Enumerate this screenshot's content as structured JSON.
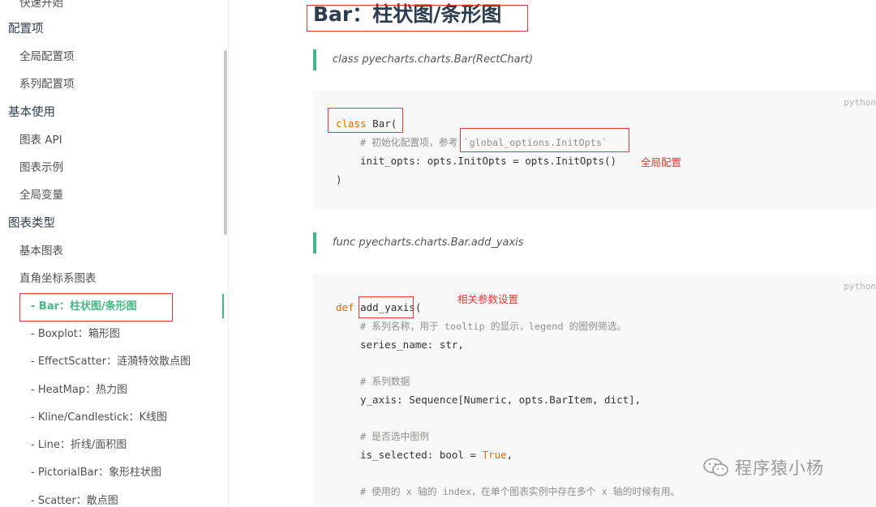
{
  "sidebar": {
    "items": [
      {
        "label": "快速开始",
        "level": 1
      },
      {
        "label": "配置项",
        "level": 0
      },
      {
        "label": "全局配置项",
        "level": 1
      },
      {
        "label": "系列配置项",
        "level": 1
      },
      {
        "label": "基本使用",
        "level": 0
      },
      {
        "label": "图表 API",
        "level": 1
      },
      {
        "label": "图表示例",
        "level": 1
      },
      {
        "label": "全局变量",
        "level": 1
      },
      {
        "label": "图表类型",
        "level": 0
      },
      {
        "label": "基本图表",
        "level": 1
      },
      {
        "label": "直角坐标系图表",
        "level": 1
      },
      {
        "label": "- Bar：柱状图/条形图",
        "level": 2,
        "active": true
      },
      {
        "label": "- Boxplot：箱形图",
        "level": 2
      },
      {
        "label": "- EffectScatter：涟漪特效散点图",
        "level": 2
      },
      {
        "label": "- HeatMap：热力图",
        "level": 2
      },
      {
        "label": "- Kline/Candlestick：K线图",
        "level": 2
      },
      {
        "label": "- Line：折线/面积图",
        "level": 2
      },
      {
        "label": "- PictorialBar：象形柱状图",
        "level": 2
      },
      {
        "label": "- Scatter：散点图",
        "level": 2
      }
    ]
  },
  "main": {
    "title": "Bar：柱状图/条形图",
    "class_signature": "class pyecharts.charts.Bar(RectChart)",
    "func_signature": "func pyecharts.charts.Bar.add_yaxis",
    "code_lang": "python",
    "block1": {
      "l1_kw": "class",
      "l1_rest": " Bar(",
      "l2": "# 初始化配置项，参考 `global_options.InitOpts`",
      "l3": "init_opts: opts.InitOpts = opts.InitOpts()",
      "l4": ")"
    },
    "block2": {
      "l1_kw": "def",
      "l1_rest": " add_yaxis(",
      "l2": "# 系列名称，用于 tooltip 的显示，legend 的图例筛选。",
      "l3": "series_name: str,",
      "l4": "# 系列数据",
      "l5": "y_axis: Sequence[Numeric, opts.BarItem, dict],",
      "l6": "# 是否选中图例",
      "l7_a": "is_selected: bool = ",
      "l7_b": "True",
      "l7_c": ",",
      "l8": "# 使用的 x 轴的 index，在单个图表实例中存在多个 x 轴的时候有用。"
    },
    "annotations": {
      "global_config": "全局配置",
      "param_settings": "相关参数设置"
    },
    "watermark": "程序猿小杨",
    "colors": {
      "accent": "#42b983",
      "keyword": "#e96900",
      "annotation": "#e53935"
    }
  }
}
